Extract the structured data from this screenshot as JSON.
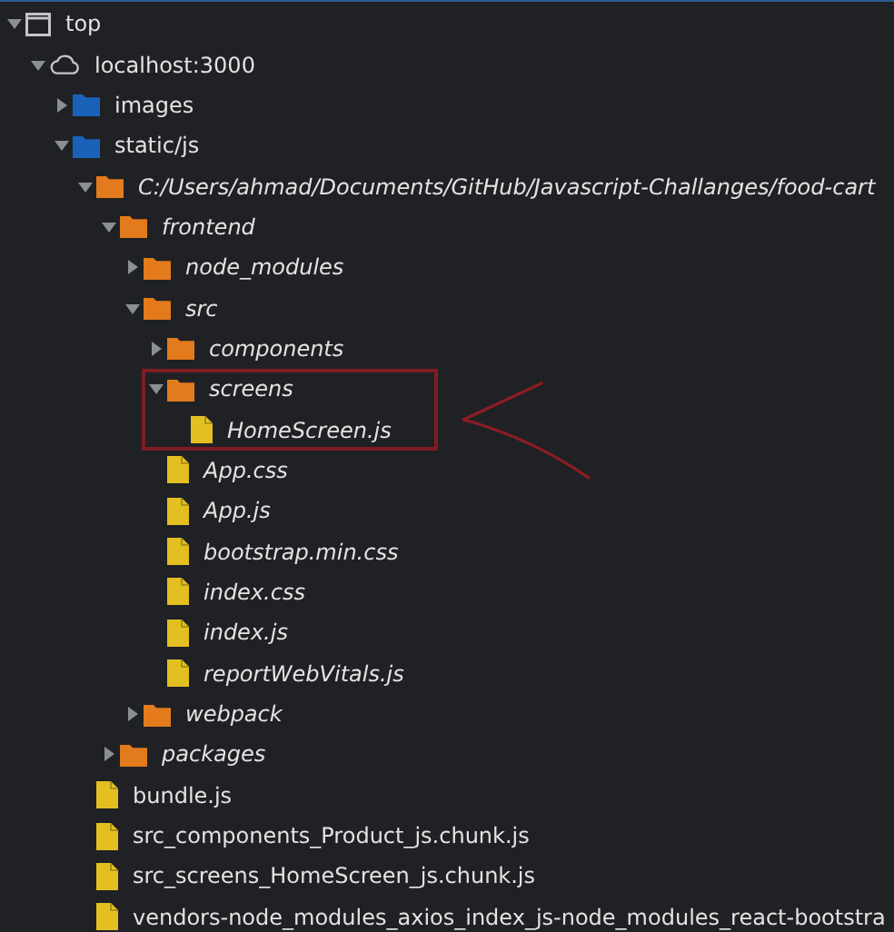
{
  "tree": [
    {
      "kind": "frame",
      "label": "top",
      "expanded": true,
      "children": [
        {
          "kind": "origin",
          "label": "localhost:3000",
          "expanded": true,
          "children": [
            {
              "kind": "domain-folder",
              "label": "images",
              "expanded": false
            },
            {
              "kind": "domain-folder",
              "label": "static/js",
              "expanded": true,
              "children": [
                {
                  "kind": "fs-folder",
                  "label": "C:/Users/ahmad/Documents/GitHub/Javascript-Challanges/food-cart",
                  "expanded": true,
                  "children": [
                    {
                      "kind": "fs-folder",
                      "label": "frontend",
                      "expanded": true,
                      "children": [
                        {
                          "kind": "fs-folder",
                          "label": "node_modules",
                          "expanded": false
                        },
                        {
                          "kind": "fs-folder",
                          "label": "src",
                          "expanded": true,
                          "children": [
                            {
                              "kind": "fs-folder",
                              "label": "components",
                              "expanded": false
                            },
                            {
                              "kind": "fs-folder",
                              "label": "screens",
                              "expanded": true,
                              "children": [
                                {
                                  "kind": "fs-file",
                                  "label": "HomeScreen.js"
                                }
                              ]
                            },
                            {
                              "kind": "fs-file",
                              "label": "App.css"
                            },
                            {
                              "kind": "fs-file",
                              "label": "App.js"
                            },
                            {
                              "kind": "fs-file",
                              "label": "bootstrap.min.css"
                            },
                            {
                              "kind": "fs-file",
                              "label": "index.css"
                            },
                            {
                              "kind": "fs-file",
                              "label": "index.js"
                            },
                            {
                              "kind": "fs-file",
                              "label": "reportWebVitals.js"
                            }
                          ]
                        },
                        {
                          "kind": "fs-folder",
                          "label": "webpack",
                          "expanded": false
                        }
                      ]
                    },
                    {
                      "kind": "fs-folder",
                      "label": "packages",
                      "expanded": false
                    }
                  ]
                },
                {
                  "kind": "file",
                  "label": "bundle.js"
                },
                {
                  "kind": "file",
                  "label": "src_components_Product_js.chunk.js"
                },
                {
                  "kind": "file",
                  "label": "src_screens_HomeScreen_js.chunk.js"
                },
                {
                  "kind": "file",
                  "label": "vendors-node_modules_axios_index_js-node_modules_react-bootstra"
                }
              ]
            }
          ]
        }
      ]
    }
  ]
}
